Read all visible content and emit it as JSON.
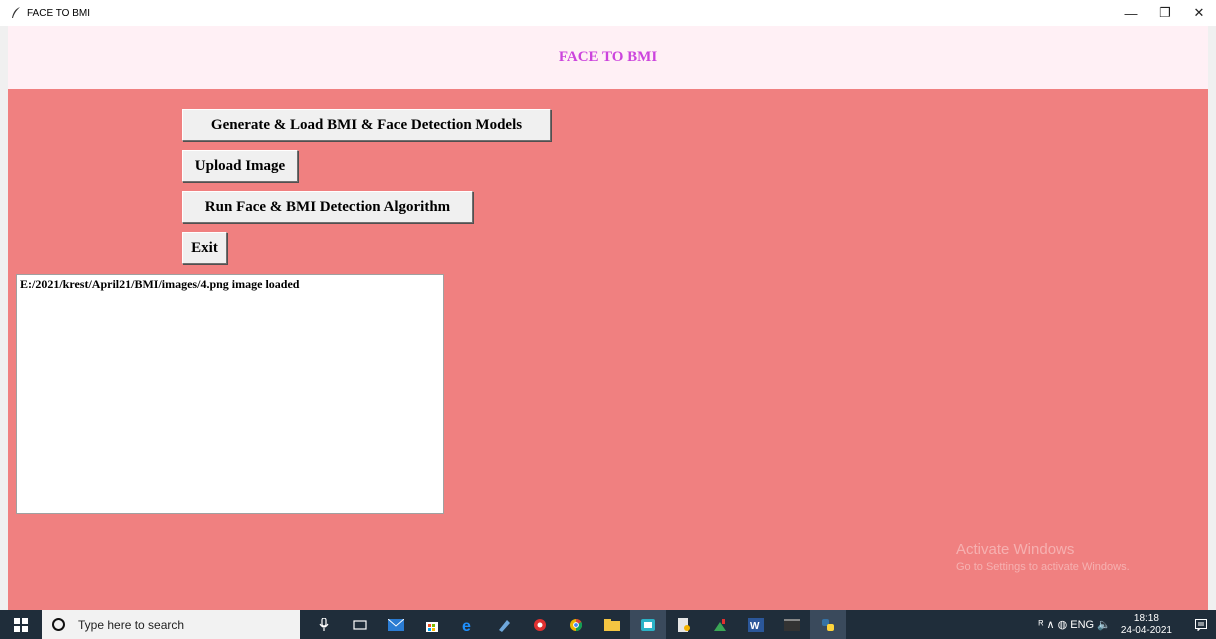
{
  "window": {
    "title": "FACE TO BMI",
    "minimize": "—",
    "restore": "❐",
    "close": "✕"
  },
  "header": {
    "title": "FACE TO BMI"
  },
  "buttons": {
    "generate": "Generate & Load BMI & Face Detection Models",
    "upload": "Upload Image",
    "run": "Run Face & BMI Detection Algorithm",
    "exit": "Exit"
  },
  "output": {
    "text": "E:/2021/krest/April21/BMI/images/4.png image loaded"
  },
  "watermark": {
    "line1": "Activate Windows",
    "line2": "Go to Settings to activate Windows."
  },
  "taskbar": {
    "search_placeholder": "Type here to search",
    "tray_symbols": "ᴿ  ∧  ◍  ENG  🔈",
    "time": "18:18",
    "date": "24-04-2021"
  },
  "colors": {
    "app_background": "#f08080",
    "header_background": "#fff0f5",
    "header_text": "#cc44dd",
    "taskbar": "#1f2d3a"
  }
}
